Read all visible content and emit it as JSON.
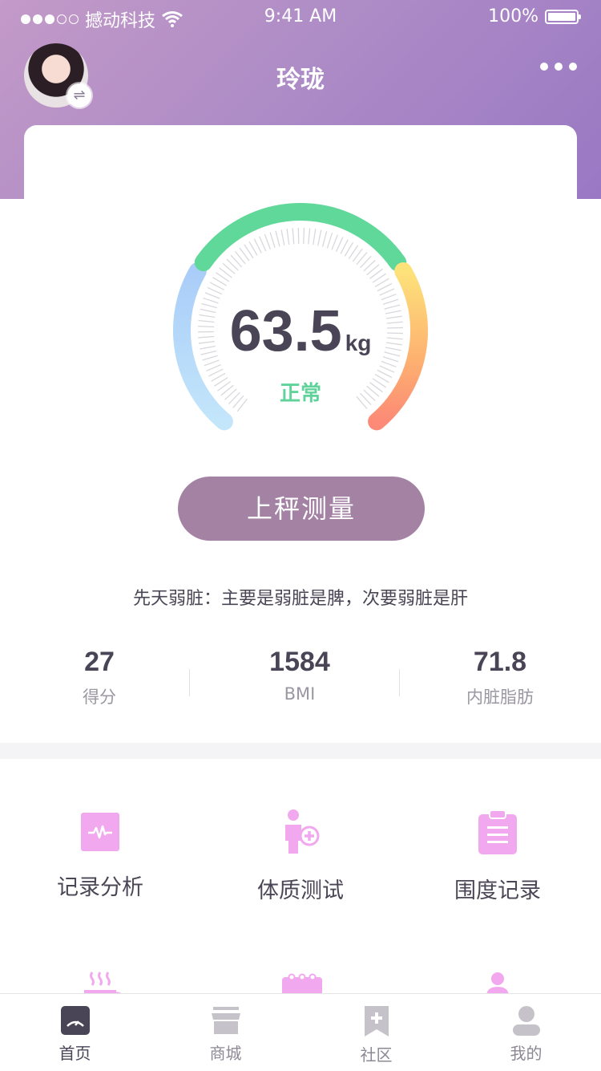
{
  "status_bar": {
    "carrier": "撼动科技",
    "time": "9:41 AM",
    "battery": "100%"
  },
  "header": {
    "user_name": "玲珑"
  },
  "gauge": {
    "value": "63.5",
    "unit": "kg",
    "status": "正常",
    "level": 0.55
  },
  "measure_button": {
    "label": "上秤测量"
  },
  "constitution_text": "先天弱脏：主要是弱脏是脾，次要弱脏是肝",
  "stats": [
    {
      "value": "27",
      "label": "得分"
    },
    {
      "value": "1584",
      "label": "BMI"
    },
    {
      "value": "71.8",
      "label": "内脏脂肪"
    }
  ],
  "features": [
    {
      "label": "记录分析",
      "icon": "record-analysis-icon"
    },
    {
      "label": "体质测试",
      "icon": "constitution-test-icon"
    },
    {
      "label": "围度记录",
      "icon": "girth-record-icon"
    },
    {
      "label": "",
      "icon": "tea-icon"
    },
    {
      "label": "",
      "icon": "calendar-icon"
    },
    {
      "label": "",
      "icon": "person-icon"
    }
  ],
  "tabbar": [
    {
      "label": "首页",
      "icon": "scale-icon",
      "active": true
    },
    {
      "label": "商城",
      "icon": "store-icon",
      "active": false
    },
    {
      "label": "社区",
      "icon": "bookmark-plus-icon",
      "active": false
    },
    {
      "label": "我的",
      "icon": "user-icon",
      "active": false
    }
  ],
  "colors": {
    "accent": "#a382a3",
    "normal_green": "#5fd39a",
    "feature_pink": "#f2a8ee",
    "header_gradient_start": "#c39ac8",
    "header_gradient_end": "#9a78c4"
  }
}
